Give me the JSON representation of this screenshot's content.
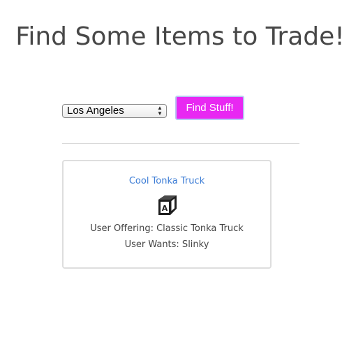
{
  "page": {
    "title": "Find Some Items to Trade!"
  },
  "search": {
    "selected_city": "Los Angeles",
    "find_label": "Find Stuff!"
  },
  "listing": {
    "item_name": "Cool Tonka Truck",
    "icon": "letter-block-icon",
    "offering": "User Offering: Classic Tonka Truck",
    "wants": "User Wants: Slinky"
  },
  "colors": {
    "accent_button": "#e828f2",
    "link": "#3a7bd5",
    "title_text": "#474747"
  }
}
